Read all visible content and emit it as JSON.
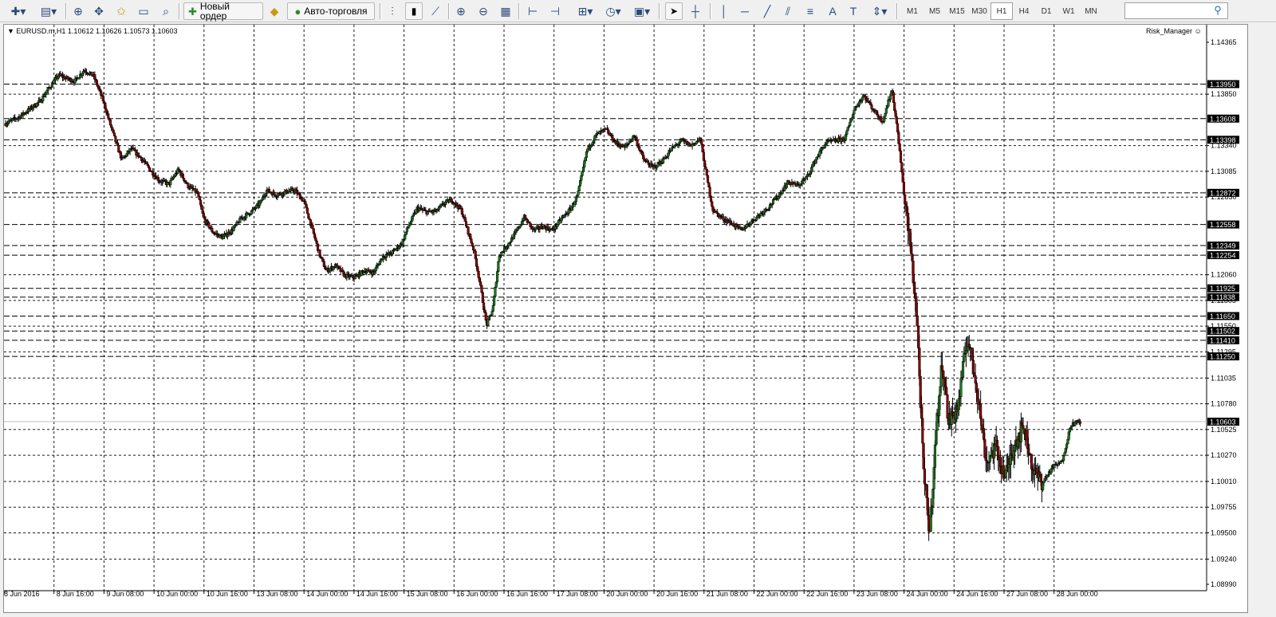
{
  "toolbar": {
    "new_order_label": "Новый ордер",
    "autotrading_label": "Авто-торговля",
    "timeframes": [
      "M1",
      "M5",
      "M15",
      "M30",
      "H1",
      "H4",
      "D1",
      "W1",
      "MN"
    ],
    "active_timeframe": "H1"
  },
  "chart": {
    "symbol_info": "EURUSD.m,H1  1.10612 1.10626 1.10573 1.10603",
    "expert_label": "Risk_Manager",
    "current_price": "1.10603",
    "bull_color": "#1f7a1f",
    "bear_color": "#8b0000"
  },
  "chart_data": {
    "type": "candlestick",
    "symbol": "EURUSD.m",
    "timeframe": "H1",
    "ohlc_last": {
      "open": 1.10612,
      "high": 1.10626,
      "low": 1.10573,
      "close": 1.10603
    },
    "ylim": [
      1.0899,
      1.14365
    ],
    "yticks": [
      "1.14365",
      "1.13850",
      "1.13340",
      "1.13085",
      "1.12830",
      "1.12060",
      "1.11805",
      "1.11550",
      "1.11295",
      "1.11035",
      "1.10780",
      "1.10525",
      "1.10270",
      "1.10010",
      "1.09755",
      "1.09500",
      "1.09240",
      "1.08990"
    ],
    "xticks": [
      "8 Jun 2016",
      "8 Jun 16:00",
      "9 Jun 08:00",
      "10 Jun 00:00",
      "10 Jun 16:00",
      "13 Jun 08:00",
      "14 Jun 00:00",
      "14 Jun 16:00",
      "15 Jun 08:00",
      "16 Jun 00:00",
      "16 Jun 16:00",
      "17 Jun 08:00",
      "20 Jun 00:00",
      "20 Jun 16:00",
      "21 Jun 08:00",
      "22 Jun 00:00",
      "22 Jun 16:00",
      "23 Jun 08:00",
      "24 Jun 00:00",
      "24 Jun 16:00",
      "27 Jun 08:00",
      "28 Jun 00:00"
    ],
    "hlines": [
      "1.13950",
      "1.13608",
      "1.13398",
      "1.12872",
      "1.12558",
      "1.12349",
      "1.12254",
      "1.11925",
      "1.11838",
      "1.11650",
      "1.11502",
      "1.11410",
      "1.11250"
    ],
    "current_line": 1.10603,
    "close_path": [
      [
        0,
        1.1356
      ],
      [
        4,
        1.1362
      ],
      [
        8,
        1.1371
      ],
      [
        11,
        1.1378
      ],
      [
        14,
        1.1392
      ],
      [
        17,
        1.1404
      ],
      [
        19,
        1.1401
      ],
      [
        22,
        1.1398
      ],
      [
        25,
        1.1409
      ],
      [
        28,
        1.1403
      ],
      [
        31,
        1.1379
      ],
      [
        33,
        1.1358
      ],
      [
        35,
        1.1338
      ],
      [
        37,
        1.132
      ],
      [
        40,
        1.1331
      ],
      [
        43,
        1.1322
      ],
      [
        46,
        1.131
      ],
      [
        49,
        1.1299
      ],
      [
        52,
        1.1296
      ],
      [
        55,
        1.131
      ],
      [
        58,
        1.1294
      ],
      [
        61,
        1.1287
      ],
      [
        63,
        1.1262
      ],
      [
        66,
        1.1248
      ],
      [
        69,
        1.1243
      ],
      [
        72,
        1.125
      ],
      [
        75,
        1.1262
      ],
      [
        78,
        1.1268
      ],
      [
        81,
        1.1277
      ],
      [
        83,
        1.129
      ],
      [
        86,
        1.1285
      ],
      [
        89,
        1.1288
      ],
      [
        92,
        1.129
      ],
      [
        95,
        1.1278
      ],
      [
        97,
        1.1257
      ],
      [
        100,
        1.1225
      ],
      [
        102,
        1.121
      ],
      [
        105,
        1.1215
      ],
      [
        108,
        1.1205
      ],
      [
        111,
        1.1203
      ],
      [
        114,
        1.121
      ],
      [
        117,
        1.1208
      ],
      [
        120,
        1.1224
      ],
      [
        123,
        1.1228
      ],
      [
        126,
        1.1237
      ],
      [
        128,
        1.1253
      ],
      [
        131,
        1.1272
      ],
      [
        134,
        1.1268
      ],
      [
        137,
        1.1269
      ],
      [
        140,
        1.1278
      ],
      [
        142,
        1.128
      ],
      [
        145,
        1.127
      ],
      [
        147,
        1.125
      ],
      [
        149,
        1.123
      ],
      [
        151,
        1.1196
      ],
      [
        153,
        1.1156
      ],
      [
        155,
        1.1172
      ],
      [
        157,
        1.1225
      ],
      [
        160,
        1.1237
      ],
      [
        162,
        1.1246
      ],
      [
        165,
        1.1263
      ],
      [
        168,
        1.125
      ],
      [
        171,
        1.1254
      ],
      [
        174,
        1.125
      ],
      [
        177,
        1.1262
      ],
      [
        180,
        1.1272
      ],
      [
        182,
        1.1285
      ],
      [
        185,
        1.133
      ],
      [
        188,
        1.1345
      ],
      [
        191,
        1.135
      ],
      [
        194,
        1.1337
      ],
      [
        197,
        1.1332
      ],
      [
        200,
        1.1344
      ],
      [
        203,
        1.132
      ],
      [
        206,
        1.1312
      ],
      [
        209,
        1.1319
      ],
      [
        212,
        1.1331
      ],
      [
        215,
        1.1339
      ],
      [
        218,
        1.1334
      ],
      [
        221,
        1.1341
      ],
      [
        223,
        1.1304
      ],
      [
        225,
        1.127
      ],
      [
        228,
        1.1262
      ],
      [
        231,
        1.1257
      ],
      [
        234,
        1.125
      ],
      [
        237,
        1.1258
      ],
      [
        240,
        1.1266
      ],
      [
        243,
        1.1274
      ],
      [
        246,
        1.1285
      ],
      [
        249,
        1.1298
      ],
      [
        252,
        1.1294
      ],
      [
        255,
        1.1303
      ],
      [
        258,
        1.1322
      ],
      [
        261,
        1.1337
      ],
      [
        264,
        1.1339
      ],
      [
        267,
        1.1341
      ],
      [
        270,
        1.137
      ],
      [
        273,
        1.1384
      ],
      [
        276,
        1.137
      ],
      [
        279,
        1.1358
      ],
      [
        282,
        1.139
      ],
      [
        284,
        1.1342
      ],
      [
        286,
        1.128
      ],
      [
        288,
        1.123
      ],
      [
        290,
        1.116
      ],
      [
        292,
        1.101
      ],
      [
        294,
        1.095
      ],
      [
        296,
        1.105
      ],
      [
        298,
        1.112
      ],
      [
        300,
        1.106
      ],
      [
        303,
        1.1075
      ],
      [
        306,
        1.1145
      ],
      [
        309,
        1.1095
      ],
      [
        312,
        1.102
      ],
      [
        315,
        1.1035
      ],
      [
        318,
        1.1005
      ],
      [
        321,
        1.104
      ],
      [
        324,
        1.1055
      ],
      [
        327,
        1.101
      ],
      [
        330,
        1.1
      ],
      [
        333,
        1.1015
      ],
      [
        336,
        1.102
      ],
      [
        339,
        1.1058
      ],
      [
        342,
        1.106
      ]
    ]
  }
}
